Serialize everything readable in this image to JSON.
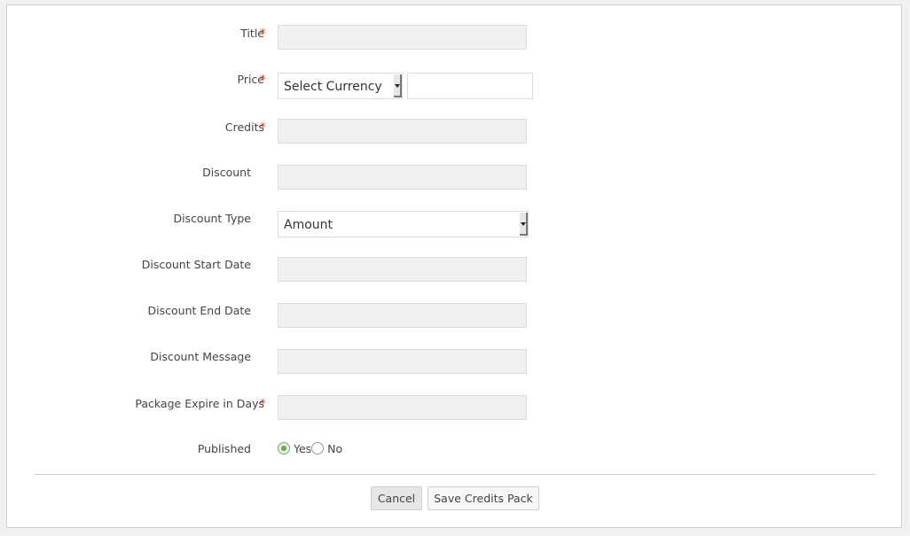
{
  "form": {
    "fields": [
      {
        "label": "Title",
        "required": true,
        "type": "text",
        "value": ""
      },
      {
        "label": "Price",
        "required": true,
        "type": "currency",
        "currency_selected": "Select Currency",
        "value": ""
      },
      {
        "label": "Credits",
        "required": true,
        "type": "text",
        "value": ""
      },
      {
        "label": "Discount",
        "required": false,
        "type": "text",
        "value": ""
      },
      {
        "label": "Discount Type",
        "required": false,
        "type": "select",
        "value": "Amount"
      },
      {
        "label": "Discount Start Date",
        "required": false,
        "type": "text",
        "value": ""
      },
      {
        "label": "Discount End Date",
        "required": false,
        "type": "text",
        "value": ""
      },
      {
        "label": "Discount Message",
        "required": false,
        "type": "text",
        "value": ""
      },
      {
        "label": "Package Expire in Days",
        "required": true,
        "type": "text",
        "value": ""
      },
      {
        "label": "Published",
        "required": false,
        "type": "radio",
        "options": [
          "Yes",
          "No"
        ],
        "selected": "Yes"
      }
    ],
    "required_marker": "*"
  },
  "buttons": {
    "cancel": "Cancel",
    "save": "Save Credits Pack"
  },
  "colors": {
    "required_star": "#e02020",
    "radio_checked": "#6aa84f"
  }
}
